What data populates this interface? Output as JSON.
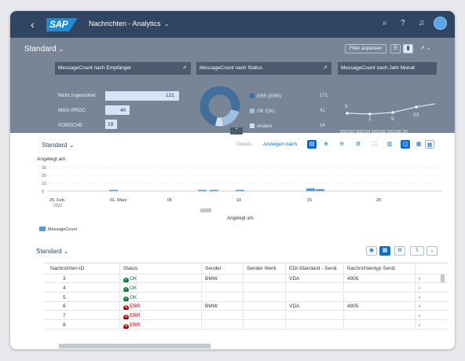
{
  "shell": {
    "back_icon": "back-arrow-icon",
    "logo_text": "SAP",
    "app_title": "Nachrichten - Analytics",
    "title_chevron": "⌄",
    "search_icon": "⌕",
    "help_icon": "?",
    "bell_icon": "♫",
    "colors": {
      "shell_bg": "#2f4562",
      "header_bg": "#778597",
      "accent": "#0a6ed1"
    }
  },
  "header": {
    "variant": "Standard",
    "variant_chevron": "⌄",
    "filter_button": "Filter anpassen",
    "view_icon_1": "☰",
    "view_icon_2": "▮",
    "share_icon": "⇗ ⌄"
  },
  "cards": {
    "recipients": {
      "title": "MessageCount nach Empfänger",
      "rows": [
        {
          "label": "Nicht zugeordnet",
          "value": "121"
        },
        {
          "label": "MSG-PROC",
          "value": "40"
        },
        {
          "label": "PORSCHE",
          "value": "19"
        }
      ]
    },
    "status": {
      "title": "MessageCount nach Status",
      "slices": [
        {
          "label": "ERR (ERR)",
          "value": "171",
          "color": "#3f6f9a"
        },
        {
          "label": "OK (OK)",
          "value": "41",
          "color": "#9fbfdc"
        },
        {
          "label": "Andere",
          "value": "14",
          "color": "#d3e1ee"
        }
      ]
    },
    "trend": {
      "title": "MessageCount nach Jahr Monat",
      "points": [
        {
          "x": "202103",
          "value": "3"
        },
        {
          "x": "202104",
          "value": "1"
        },
        {
          "x": "202105",
          "value": "5"
        },
        {
          "x": "202106",
          "value": "23"
        },
        {
          "x": "20",
          "value": ""
        }
      ]
    },
    "expand_icon": "⇗",
    "collapse_icon": "⌃"
  },
  "chart_toolbar": {
    "variant": "Standard",
    "variant_chevron": "⌄",
    "details": "Details",
    "show_by": "Anzeigen nach",
    "icons": [
      "legend-icon",
      "zoom-in-icon",
      "zoom-out-icon",
      "settings-icon",
      "fullscreen-icon",
      "bar-chart-icon",
      "line-icon",
      "column-icon",
      "table-icon"
    ],
    "glyphs": [
      "▤",
      "⊕",
      "⊖",
      "⚙",
      "⛶",
      "▥",
      "◫",
      "▦",
      "▦"
    ]
  },
  "chart_data": {
    "type": "bar",
    "title": "Angelegt am",
    "xlabel": "Angelegt am",
    "ylabel": "",
    "yticks": [
      "30",
      "20",
      "10",
      "0"
    ],
    "ylim": [
      0,
      30
    ],
    "xticks": [
      "25. Feb.",
      "01. März",
      "05",
      "10",
      "15",
      "20"
    ],
    "xtick_sub": "2022",
    "series": [
      {
        "name": "MessageCount",
        "points": [
          {
            "x": "01. März",
            "value": 1
          },
          {
            "x": "08",
            "value": 1
          },
          {
            "x": "09",
            "value": 1
          },
          {
            "x": "10",
            "value": 1
          },
          {
            "x": "15",
            "value": 3
          },
          {
            "x": "16",
            "value": 2
          }
        ]
      }
    ],
    "legend_placement": "bottom-left",
    "grid": true
  },
  "table_toolbar": {
    "variant": "Standard",
    "variant_chevron": "⌄",
    "icons": [
      "eye-icon",
      "table-view-icon",
      "settings-icon",
      "export-icon",
      "chevron-down-icon"
    ],
    "glyphs": [
      "◉",
      "▦",
      "⚙",
      "⇩",
      "⌄"
    ]
  },
  "table": {
    "columns": [
      "Nachrichten-ID",
      "Status",
      "Sender",
      "Sender Werk",
      "EDI-Standard - Send.",
      "Nachrichtentyp Send."
    ],
    "rows": [
      {
        "id": "3",
        "status": "OK",
        "sender": "BMW",
        "werk": "",
        "edi": "VDA",
        "typ": "4905"
      },
      {
        "id": "4",
        "status": "OK",
        "sender": "",
        "werk": "",
        "edi": "",
        "typ": ""
      },
      {
        "id": "5",
        "status": "OK",
        "sender": "",
        "werk": "",
        "edi": "",
        "typ": ""
      },
      {
        "id": "6",
        "status": "ERR",
        "sender": "BMW",
        "werk": "",
        "edi": "VDA",
        "typ": "4905"
      },
      {
        "id": "7",
        "status": "ERR",
        "sender": "",
        "werk": "",
        "edi": "",
        "typ": ""
      },
      {
        "id": "8",
        "status": "ERR",
        "sender": "",
        "werk": "",
        "edi": "",
        "typ": ""
      }
    ],
    "row_nav_icon": "›",
    "ok_glyph": "✓",
    "err_glyph": "✕"
  }
}
